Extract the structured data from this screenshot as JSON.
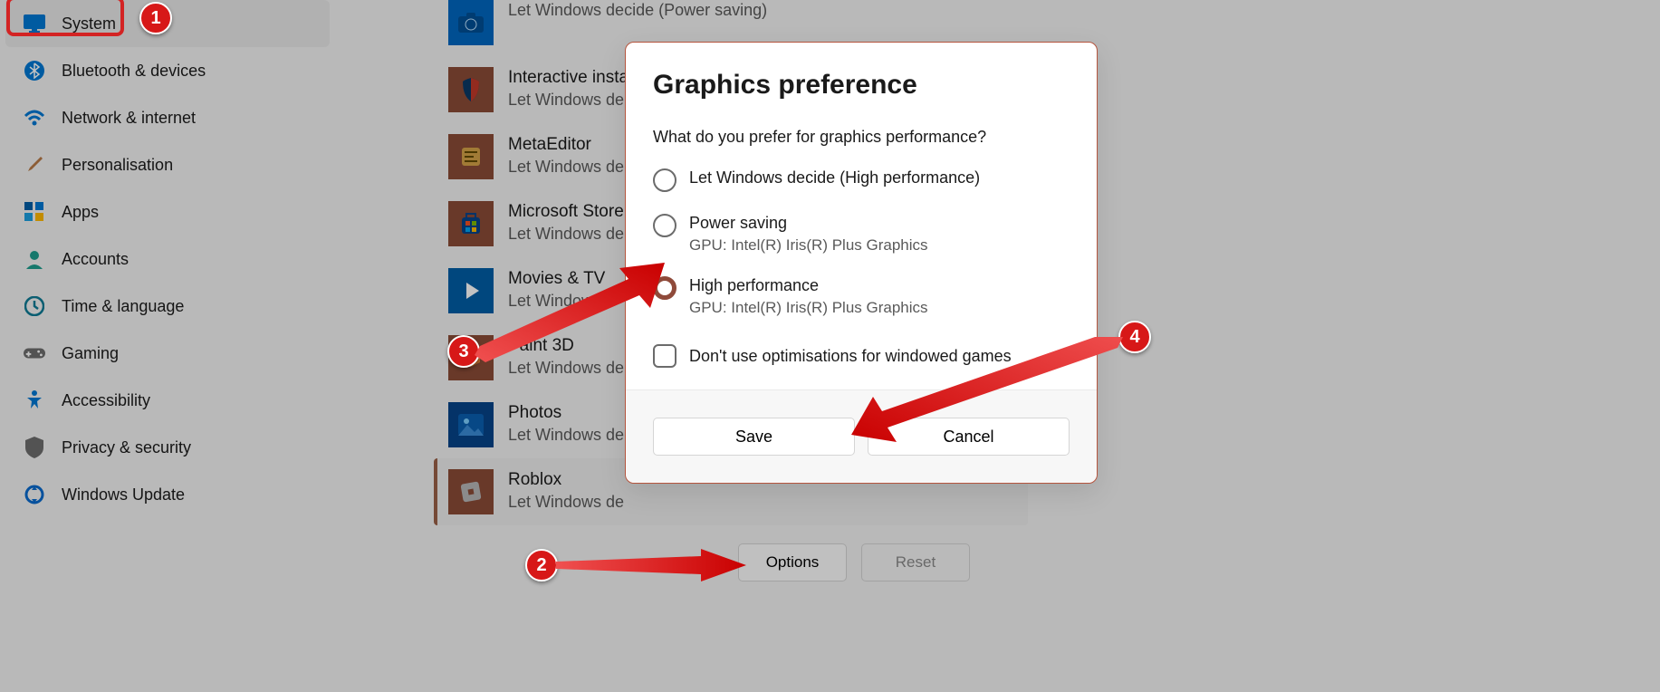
{
  "sidebar": {
    "items": [
      {
        "label": "System",
        "icon_color": "#0078d4"
      },
      {
        "label": "Bluetooth & devices",
        "icon_color": "#0078d4"
      },
      {
        "label": "Network & internet",
        "icon_color": "#0078d4"
      },
      {
        "label": "Personalisation",
        "icon_color": "#b97b47"
      },
      {
        "label": "Apps",
        "icon_color": "#005ea6"
      },
      {
        "label": "Accounts",
        "icon_color": "#1e9e8e"
      },
      {
        "label": "Time & language",
        "icon_color": "#0f7c96"
      },
      {
        "label": "Gaming",
        "icon_color": "#6e6e6e"
      },
      {
        "label": "Accessibility",
        "icon_color": "#0078d4"
      },
      {
        "label": "Privacy & security",
        "icon_color": "#6e6e6e"
      },
      {
        "label": "Windows Update",
        "icon_color": "#0a6bcf"
      }
    ]
  },
  "apps": [
    {
      "name": "",
      "sub": "Let Windows decide (Power saving)",
      "icon_bg": "#0067c0",
      "icon": "camera"
    },
    {
      "name": "Interactive insta",
      "sub": "Let Windows de",
      "icon_bg": "#8b4b37",
      "icon": "shield"
    },
    {
      "name": "MetaEditor",
      "sub": "Let Windows de",
      "icon_bg": "#8b4b37",
      "icon": "editor"
    },
    {
      "name": "Microsoft Store",
      "sub": "Let Windows de",
      "icon_bg": "#8b4b37",
      "icon": "store"
    },
    {
      "name": "Movies & TV",
      "sub": "Let Windows",
      "icon_bg": "#005ea6",
      "icon": "play"
    },
    {
      "name": "Paint 3D",
      "sub": "Let Windows de",
      "icon_bg": "#8b4b37",
      "icon": "cube"
    },
    {
      "name": "Photos",
      "sub": "Let Windows de",
      "icon_bg": "#064489",
      "icon": "photo"
    },
    {
      "name": "Roblox",
      "sub": "Let Windows de",
      "icon_bg": "#8b4b37",
      "icon": "block"
    }
  ],
  "buttons": {
    "options": "Options",
    "reset": "Reset"
  },
  "dialog": {
    "title": "Graphics preference",
    "prompt": "What do you prefer for graphics performance?",
    "options": [
      {
        "label": "Let Windows decide (High performance)"
      },
      {
        "label": "Power saving",
        "sub": "GPU: Intel(R) Iris(R) Plus Graphics"
      },
      {
        "label": "High performance",
        "sub": "GPU: Intel(R) Iris(R) Plus Graphics",
        "selected": true
      }
    ],
    "checkbox": "Don't use optimisations for windowed games",
    "save": "Save",
    "cancel": "Cancel"
  },
  "markers": {
    "m1": "1",
    "m2": "2",
    "m3": "3",
    "m4": "4"
  }
}
